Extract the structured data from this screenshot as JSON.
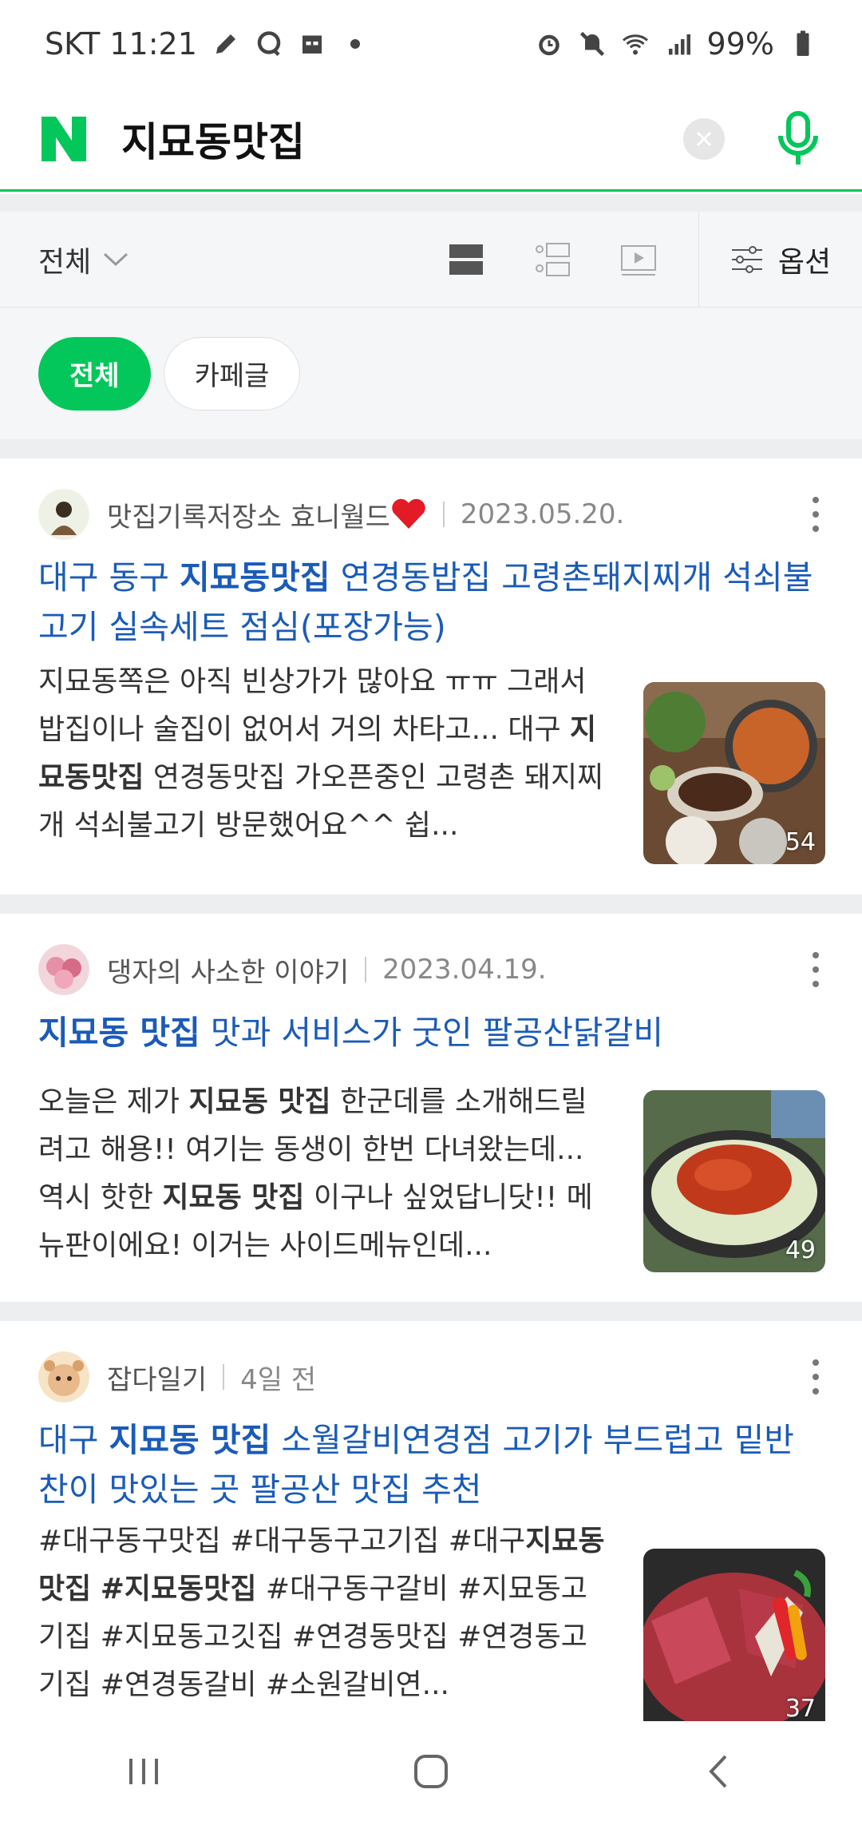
{
  "status": {
    "carrier_time": "SKT 11:21",
    "battery": "99%"
  },
  "search": {
    "query": "지묘동맛집"
  },
  "filters": {
    "scope": "전체",
    "options": "옵션",
    "chips": [
      "전체",
      "카페글"
    ]
  },
  "results": [
    {
      "author": "맛집기록저장소 효니월드",
      "date": "2023.05.20.",
      "title_pre": "대구 동구 ",
      "title_hl": "지묘동맛집",
      "title_post": " 연경동밥집 고령촌돼지찌개 석쇠불고기 실속세트 점심(포장가능)",
      "snippet_a": "지묘동쪽은 아직 빈상가가 많아요 ㅠㅠ 그래서 밥집이나 술집이 없어서 거의 차타고... 대구 ",
      "snippet_hl": "지묘동맛집",
      "snippet_b": " 연경동맛집 가오픈중인 고령촌 돼지찌개 석쇠불고기 방문했어요^^ 쉽...",
      "photo_count": "54"
    },
    {
      "author": "댕자의 사소한 이야기",
      "date": "2023.04.19.",
      "title_hl": "지묘동 맛집",
      "title_post": " 맛과 서비스가 굿인 팔공산닭갈비",
      "snippet_a": "오늘은 제가 ",
      "snippet_hl": "지묘동 맛집",
      "snippet_b": " 한군데를 소개해드릴려고 해용!! 여기는 동생이 한번 다녀왔는데... 역시 핫한 ",
      "snippet_hl2": "지묘동 맛집",
      "snippet_c": " 이구나 싶었답니닷!! 메뉴판이에요! 이거는 사이드메뉴인데...",
      "photo_count": "49"
    },
    {
      "author": "잡다일기",
      "date": "4일 전",
      "title_pre": "대구 ",
      "title_hl": "지묘동 맛집",
      "title_post": " 소월갈비연경점 고기가 부드럽고 밑반찬이 맛있는 곳 팔공산 맛집 추천",
      "snippet_a": "#대구동구맛집 #대구동구고기집 #대구",
      "snippet_hl": "지묘동맛집",
      "snippet_b": " ",
      "snippet_hl2": "#지묘동맛집",
      "snippet_c": " #대구동구갈비 #지묘동고기집 #지묘동고깃집 #연경동맛집 #연경동고기집 #연경동갈비 #소원갈비연...",
      "photo_count": "37"
    }
  ]
}
